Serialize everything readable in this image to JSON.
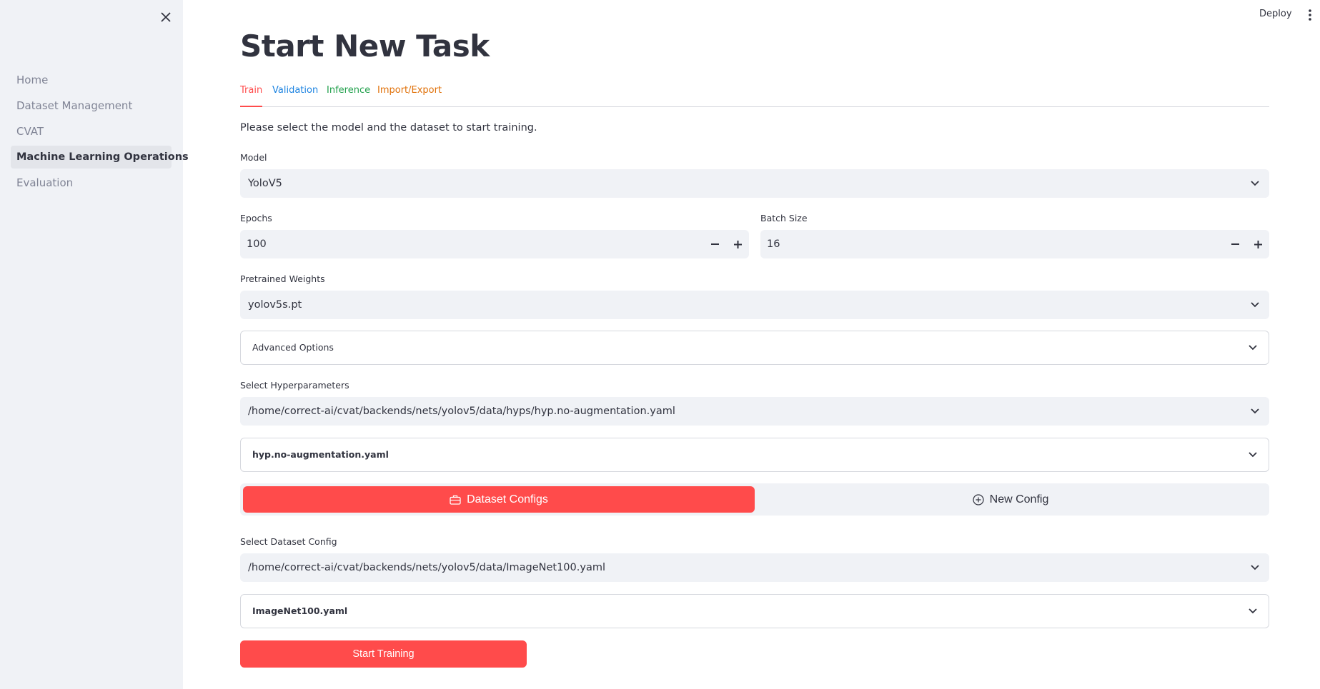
{
  "sidebar": {
    "items": [
      {
        "label": "Home"
      },
      {
        "label": "Dataset Management"
      },
      {
        "label": "CVAT"
      },
      {
        "label": "Machine Learning Operations"
      },
      {
        "label": "Evaluation"
      }
    ]
  },
  "header": {
    "deploy_label": "Deploy"
  },
  "page": {
    "title": "Start New Task",
    "tabs": [
      {
        "label": "Train",
        "color": "#ff4b4b"
      },
      {
        "label": "Validation",
        "color": "#1c83e1"
      },
      {
        "label": "Inference",
        "color": "#21a04c"
      },
      {
        "label": "Import/Export",
        "color": "#e0710a"
      }
    ],
    "intro": "Please select the model and the dataset to start training."
  },
  "form": {
    "model": {
      "label": "Model",
      "value": "YoloV5"
    },
    "epochs": {
      "label": "Epochs",
      "value": "100"
    },
    "batch_size": {
      "label": "Batch Size",
      "value": "16"
    },
    "pretrained": {
      "label": "Pretrained Weights",
      "value": "yolov5s.pt"
    },
    "advanced": {
      "label": "Advanced Options"
    },
    "hyperparams": {
      "label": "Select Hyperparameters",
      "value": "/home/correct-ai/cvat/backends/nets/yolov5/data/hyps/hyp.no-augmentation.yaml",
      "expander": "hyp.no-augmentation.yaml"
    },
    "segment": {
      "dataset_configs": "Dataset Configs",
      "new_config": "New Config"
    },
    "dataset_config": {
      "label": "Select Dataset Config",
      "value": "/home/correct-ai/cvat/backends/nets/yolov5/data/ImageNet100.yaml",
      "expander": "ImageNet100.yaml"
    },
    "start_button": "Start Training"
  },
  "colors": {
    "accent": "#ff4b4b",
    "sidebar_bg": "#f0f2f6",
    "text": "#31333f"
  }
}
